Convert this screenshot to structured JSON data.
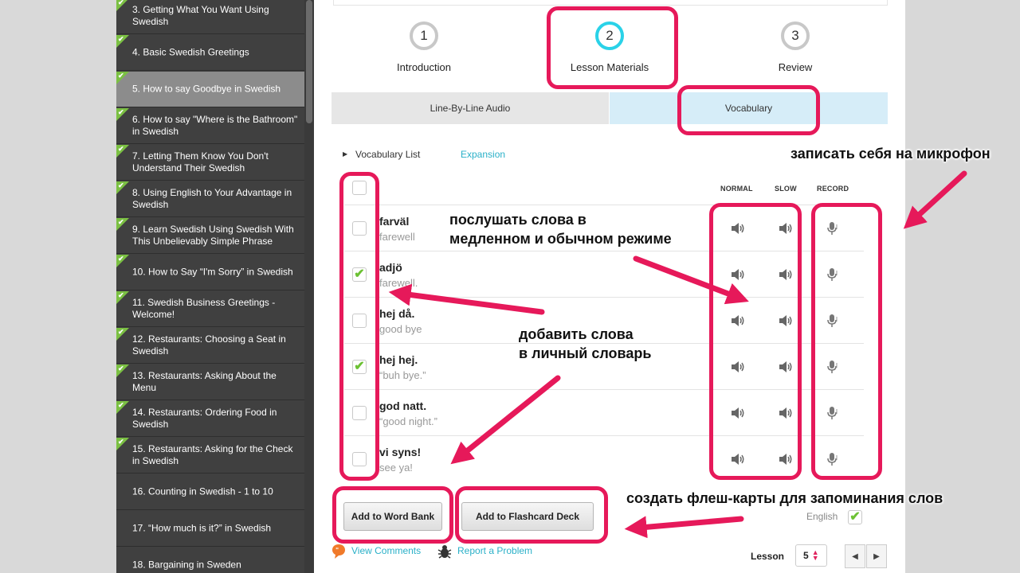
{
  "sidebar": {
    "items": [
      {
        "label": "3. Getting What You Want Using Swedish",
        "done": true,
        "active": false
      },
      {
        "label": "4. Basic Swedish Greetings",
        "done": true,
        "active": false
      },
      {
        "label": "5. How to say Goodbye in Swedish",
        "done": true,
        "active": true
      },
      {
        "label": "6. How to say \"Where is the Bathroom\" in Swedish",
        "done": true,
        "active": false
      },
      {
        "label": "7. Letting Them Know You Don't Understand Their Swedish",
        "done": true,
        "active": false
      },
      {
        "label": "8. Using English to Your Advantage in Swedish",
        "done": true,
        "active": false
      },
      {
        "label": "9. Learn Swedish Using Swedish With This Unbelievably Simple Phrase",
        "done": true,
        "active": false
      },
      {
        "label": "10. How to Say “I'm Sorry” in Swedish",
        "done": true,
        "active": false
      },
      {
        "label": "11. Swedish Business Greetings - Welcome!",
        "done": true,
        "active": false
      },
      {
        "label": "12. Restaurants: Choosing a Seat in Swedish",
        "done": true,
        "active": false
      },
      {
        "label": "13. Restaurants: Asking About the Menu",
        "done": true,
        "active": false
      },
      {
        "label": "14. Restaurants: Ordering Food in Swedish",
        "done": true,
        "active": false
      },
      {
        "label": "15. Restaurants: Asking for the Check in Swedish",
        "done": true,
        "active": false
      },
      {
        "label": "16. Counting in Swedish - 1 to 10",
        "done": false,
        "active": false
      },
      {
        "label": "17. “How much is it?” in Swedish",
        "done": false,
        "active": false
      },
      {
        "label": "18. Bargaining in Sweden",
        "done": false,
        "active": false
      }
    ]
  },
  "steps": [
    {
      "number": "1",
      "label": "Introduction"
    },
    {
      "number": "2",
      "label": "Lesson Materials"
    },
    {
      "number": "3",
      "label": "Review"
    }
  ],
  "tabs": {
    "audio": "Line-By-Line Audio",
    "vocab": "Vocabulary"
  },
  "vocab": {
    "list_label": "Vocabulary List",
    "expansion_label": "Expansion",
    "col_normal": "NORMAL",
    "col_slow": "SLOW",
    "col_record": "RECORD",
    "rows": [
      {
        "word": "farväl",
        "translation": "farewell",
        "checked": false
      },
      {
        "word": "adjö",
        "translation": "farewell.",
        "checked": true
      },
      {
        "word": "hej då.",
        "translation": "good bye",
        "checked": false
      },
      {
        "word": "hej hej.",
        "translation": "“buh bye.”",
        "checked": true
      },
      {
        "word": "god natt.",
        "translation": "“good night.”",
        "checked": false
      },
      {
        "word": "vi syns!",
        "translation": "see ya!",
        "checked": false
      }
    ]
  },
  "buttons": {
    "word_bank": "Add to Word Bank",
    "flashcard": "Add to Flashcard Deck"
  },
  "english_label": "English",
  "links": {
    "comments": "View Comments",
    "problem": "Report a Problem"
  },
  "lesson": {
    "label": "Lesson",
    "value": "5"
  },
  "annotations": {
    "record": "записать себя на микрофон",
    "listen_line1": "послушать слова в",
    "listen_line2": "медленном и обычном режиме",
    "add_line1": "добавить слова",
    "add_line2": "в личный словарь",
    "flash": "создать флеш-карты для запоминания слов"
  },
  "colors": {
    "highlight": "#e6195a",
    "accent": "#2ad2e8",
    "link": "#2ab0c8",
    "check": "#6cc133",
    "done_corner": "#7bc043"
  }
}
